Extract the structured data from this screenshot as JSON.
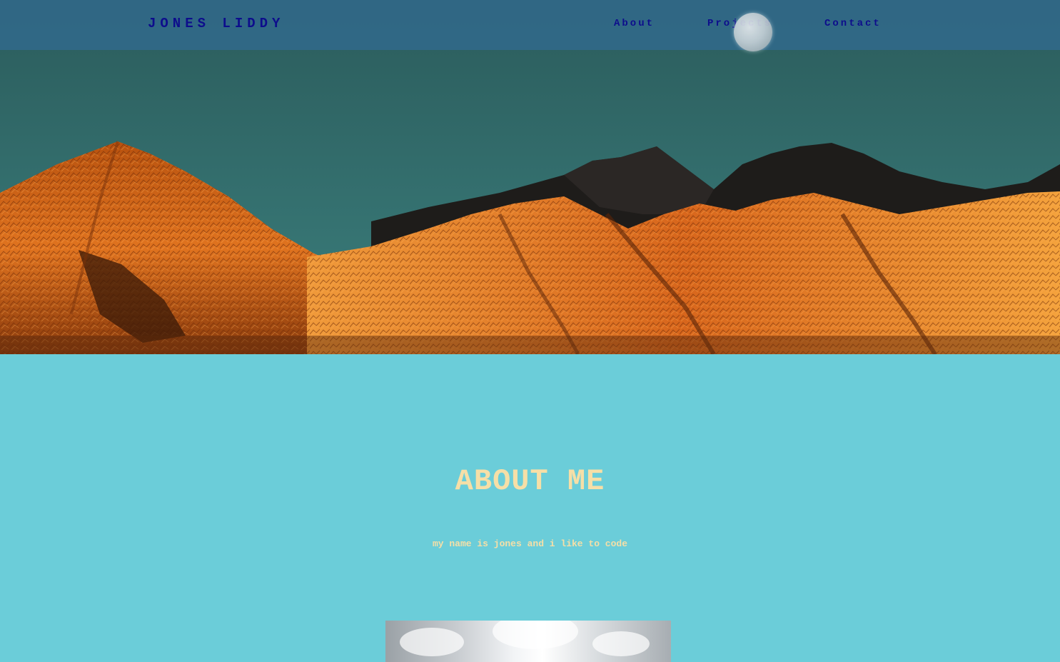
{
  "site": {
    "brand": "JONES LIDDY"
  },
  "nav": {
    "items": [
      {
        "label": "About"
      },
      {
        "label": "Projects"
      },
      {
        "label": "Contact"
      }
    ]
  },
  "about": {
    "heading": "ABOUT ME",
    "text": "my name is jones and i like to code"
  },
  "colors": {
    "page_background": "#6bcdd9",
    "navbar": "#306888",
    "nav_text": "#0d0d8c",
    "heading_text": "#f6dfa7",
    "sky": "#337271",
    "mountain_lit": "#d9651c"
  }
}
